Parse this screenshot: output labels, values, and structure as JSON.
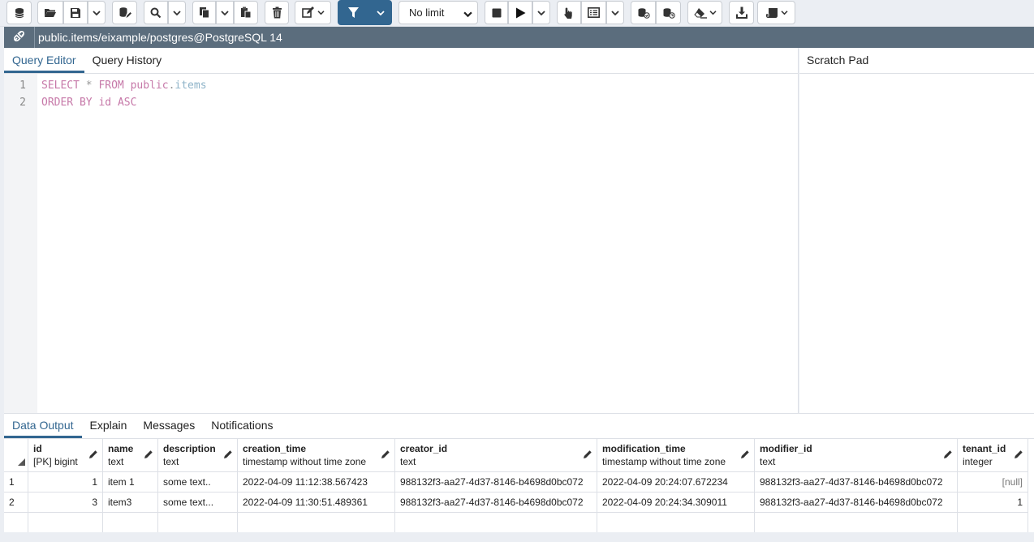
{
  "toolbar": {
    "limit_value": "No limit"
  },
  "connection": {
    "title": "public.items/eixample/postgres@PostgreSQL 14"
  },
  "editor": {
    "tabs": [
      "Query Editor",
      "Query History"
    ],
    "line_numbers": [
      "1",
      "2"
    ],
    "line1": {
      "kw1": "SELECT",
      "op": "*",
      "kw2": "FROM",
      "schema": "public",
      "dot": ".",
      "table": "items"
    },
    "line2": {
      "kw1": "ORDER BY",
      "col": "id",
      "kw2": "ASC"
    }
  },
  "scratch": {
    "title": "Scratch Pad"
  },
  "results": {
    "tabs": [
      "Data Output",
      "Explain",
      "Messages",
      "Notifications"
    ],
    "columns": [
      {
        "name": "id",
        "type": "[PK] bigint"
      },
      {
        "name": "name",
        "type": "text"
      },
      {
        "name": "description",
        "type": "text"
      },
      {
        "name": "creation_time",
        "type": "timestamp without time zone"
      },
      {
        "name": "creator_id",
        "type": "text"
      },
      {
        "name": "modification_time",
        "type": "timestamp without time zone"
      },
      {
        "name": "modifier_id",
        "type": "text"
      },
      {
        "name": "tenant_id",
        "type": "integer"
      }
    ],
    "rows": [
      {
        "rownum": "1",
        "cells": [
          "1",
          "item 1",
          "some text..",
          "2022-04-09 11:12:38.567423",
          "988132f3-aa27-4d37-8146-b4698d0bc072",
          "2022-04-09 20:24:07.672234",
          "988132f3-aa27-4d37-8146-b4698d0bc072",
          "[null]"
        ]
      },
      {
        "rownum": "2",
        "cells": [
          "3",
          "item3",
          "some text...",
          "2022-04-09 11:30:51.489361",
          "988132f3-aa27-4d37-8146-b4698d0bc072",
          "2022-04-09 20:24:34.309011",
          "988132f3-aa27-4d37-8146-b4698d0bc072",
          "1"
        ]
      }
    ]
  },
  "colors": {
    "accent": "#326690",
    "connbar": "#5b6d7d",
    "keyword": "#c678a8",
    "identifier": "#8fb4c9"
  }
}
